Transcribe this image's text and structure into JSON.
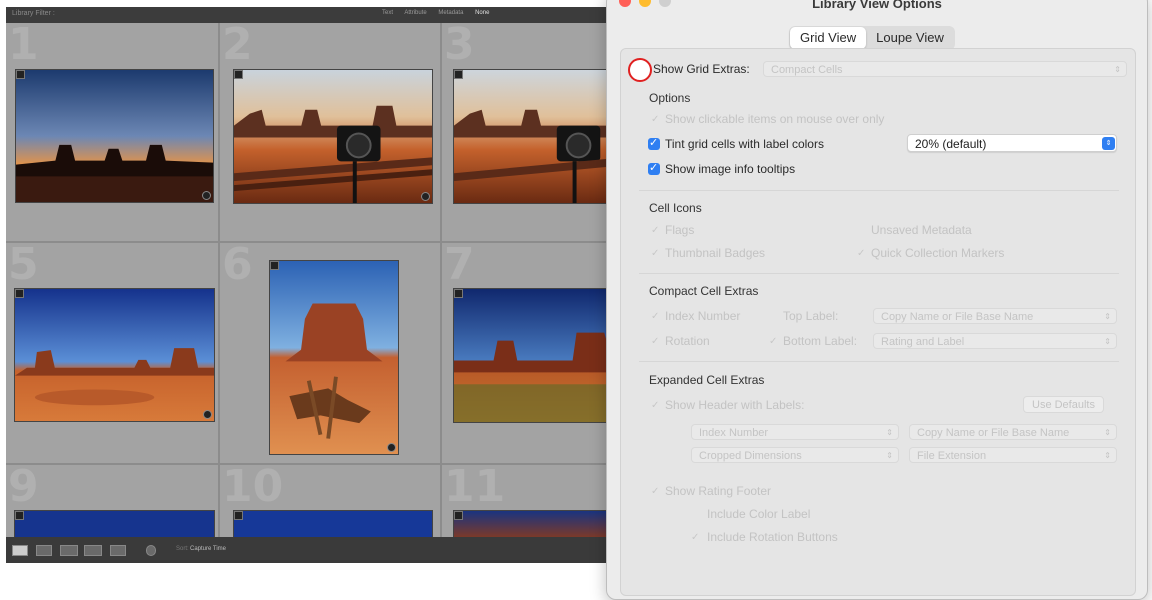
{
  "lightroom": {
    "filter_bar": {
      "label": "Library Filter :",
      "options": [
        "Text",
        "Attribute",
        "Metadata",
        "None"
      ],
      "active": "None"
    },
    "cells": [
      {
        "number": "1"
      },
      {
        "number": "2"
      },
      {
        "number": "3"
      },
      {
        "number": "5"
      },
      {
        "number": "6"
      },
      {
        "number": "7"
      },
      {
        "number": "9"
      },
      {
        "number": "10"
      },
      {
        "number": "11"
      }
    ],
    "toolbar": {
      "sort_label": "Sort:",
      "sort_value": "Capture Time"
    }
  },
  "dialog": {
    "title": "Library View Options",
    "tabs": [
      {
        "label": "Grid View",
        "selected": true
      },
      {
        "label": "Loupe View",
        "selected": false
      }
    ],
    "show_grid_extras": {
      "label": "Show Grid Extras:",
      "value": "Compact Cells"
    },
    "options": {
      "heading": "Options",
      "clickable_items": "Show clickable items on mouse over only",
      "tint_cells": "Tint grid cells with label colors",
      "tint_value": "20% (default)",
      "image_info_tooltips": "Show image info tooltips"
    },
    "cell_icons": {
      "heading": "Cell Icons",
      "flags": "Flags",
      "unsaved_metadata": "Unsaved Metadata",
      "thumbnail_badges": "Thumbnail Badges",
      "quick_collection": "Quick Collection Markers"
    },
    "compact_cell_extras": {
      "heading": "Compact Cell Extras",
      "index_number": "Index Number",
      "top_label": "Top Label:",
      "top_label_value": "Copy Name or File Base Name",
      "rotation": "Rotation",
      "bottom_label": "Bottom Label:",
      "bottom_label_value": "Rating and Label"
    },
    "expanded_cell_extras": {
      "heading": "Expanded Cell Extras",
      "show_header": "Show Header with Labels:",
      "use_defaults": "Use Defaults",
      "field1": "Index Number",
      "field2": "Copy Name or File Base Name",
      "field3": "Cropped Dimensions",
      "field4": "File Extension",
      "show_rating_footer": "Show Rating Footer",
      "include_color_label": "Include Color Label",
      "include_rotation_buttons": "Include Rotation Buttons"
    }
  },
  "colors": {
    "accent": "#2f7ff2",
    "marker": "#e02020"
  }
}
